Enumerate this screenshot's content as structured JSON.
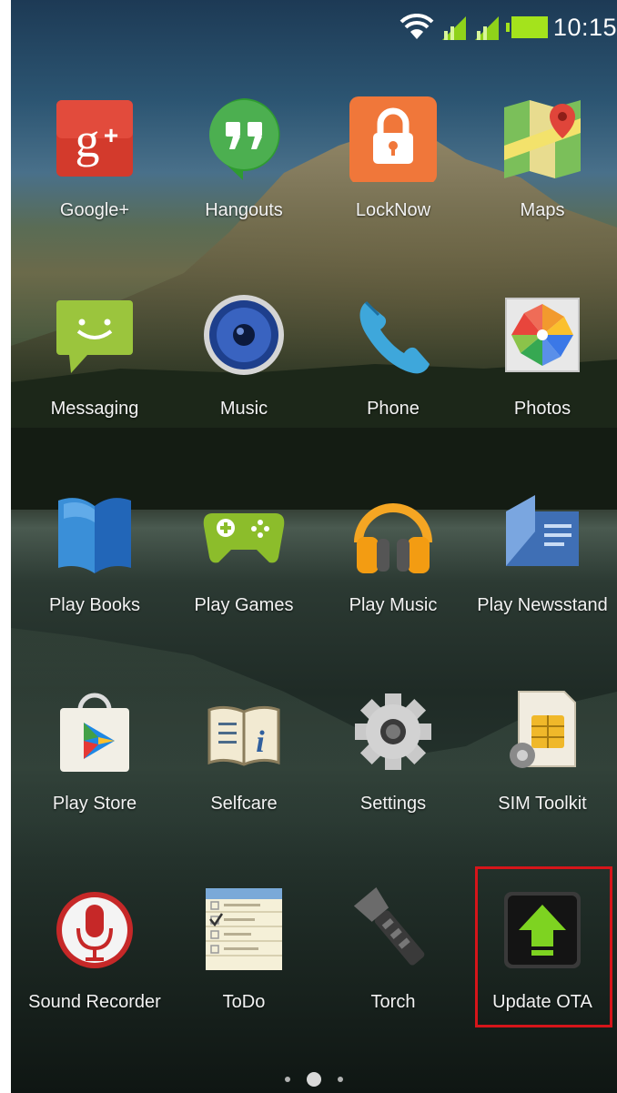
{
  "status_bar": {
    "time": "10:15",
    "icons": [
      "wifi-icon",
      "signal-icon",
      "signal-icon",
      "battery-icon"
    ]
  },
  "apps": [
    {
      "label": "Google+",
      "icon": "google-plus-icon"
    },
    {
      "label": "Hangouts",
      "icon": "hangouts-icon"
    },
    {
      "label": "LockNow",
      "icon": "lock-icon"
    },
    {
      "label": "Maps",
      "icon": "maps-icon"
    },
    {
      "label": "Messaging",
      "icon": "messaging-icon"
    },
    {
      "label": "Music",
      "icon": "music-speaker-icon"
    },
    {
      "label": "Phone",
      "icon": "phone-icon"
    },
    {
      "label": "Photos",
      "icon": "photos-icon"
    },
    {
      "label": "Play Books",
      "icon": "play-books-icon"
    },
    {
      "label": "Play Games",
      "icon": "play-games-icon"
    },
    {
      "label": "Play Music",
      "icon": "play-music-icon"
    },
    {
      "label": "Play Newsstand",
      "icon": "play-newsstand-icon"
    },
    {
      "label": "Play Store",
      "icon": "play-store-icon"
    },
    {
      "label": "Selfcare",
      "icon": "selfcare-icon"
    },
    {
      "label": "Settings",
      "icon": "gear-icon"
    },
    {
      "label": "SIM Toolkit",
      "icon": "sim-toolkit-icon"
    },
    {
      "label": "Sound Recorder",
      "icon": "microphone-icon"
    },
    {
      "label": "ToDo",
      "icon": "todo-icon"
    },
    {
      "label": "Torch",
      "icon": "torch-icon"
    },
    {
      "label": "Update OTA",
      "icon": "update-arrow-icon"
    }
  ],
  "page_indicator": {
    "pages": 3,
    "current": 2
  },
  "colors": {
    "highlight": "#d6151a",
    "battery": "#a4e31c",
    "signal": "#8fd21a"
  }
}
